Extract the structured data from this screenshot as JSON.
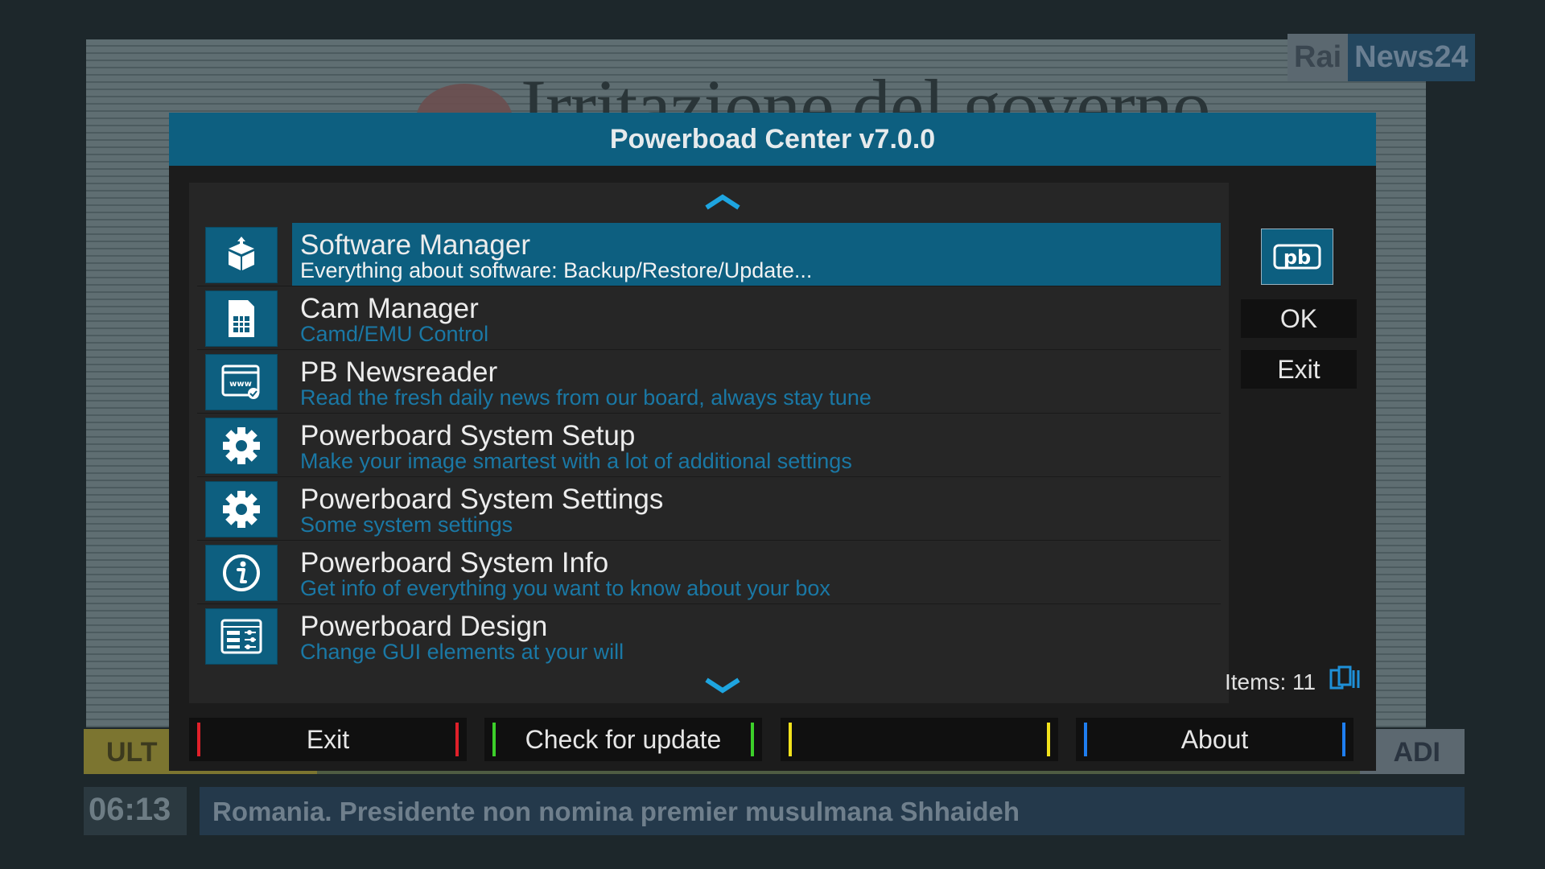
{
  "background": {
    "headline": "Irritazione del governo",
    "channel": {
      "rai": "Rai",
      "news": "News24"
    },
    "ticker": {
      "left": "ULT",
      "right": "ADI"
    },
    "clock": "06:13",
    "crawl": "Romania. Presidente non nomina premier musulmana Shhaideh"
  },
  "dialog": {
    "title": "Powerboad Center v7.0.0",
    "menu": [
      {
        "title": "Software Manager",
        "subtitle": "Everything about software: Backup/Restore/Update...",
        "icon": "package-icon",
        "selected": true
      },
      {
        "title": "Cam Manager",
        "subtitle": "Camd/EMU Control",
        "icon": "sim-card-icon",
        "selected": false
      },
      {
        "title": "PB Newsreader",
        "subtitle": "Read the fresh daily news from our board, always stay tune",
        "icon": "www-browser-icon",
        "selected": false
      },
      {
        "title": "Powerboard System Setup",
        "subtitle": "Make your image smartest with a lot of additional settings",
        "icon": "gear-icon",
        "selected": false
      },
      {
        "title": "Powerboard System Settings",
        "subtitle": "Some system settings",
        "icon": "gear-icon",
        "selected": false
      },
      {
        "title": "Powerboard System Info",
        "subtitle": "Get info of everything you want to know about your box",
        "icon": "info-icon",
        "selected": false
      },
      {
        "title": "Powerboard Design",
        "subtitle": "Change GUI elements at your will",
        "icon": "design-panel-icon",
        "selected": false
      }
    ],
    "side": {
      "logo_text": "pb",
      "ok_label": "OK",
      "exit_label": "Exit",
      "items_label": "Items: 11"
    },
    "footer": {
      "red": "Exit",
      "green": "Check for update",
      "yellow": "",
      "blue": "About"
    }
  },
  "colors": {
    "accent": "#0d5f80",
    "subtitle": "#1a78a5",
    "arrow": "#1ea5e0",
    "red_key": "#e0202a",
    "green_key": "#3ccf2a",
    "yellow_key": "#f2e21c",
    "blue_key": "#1f7ef0"
  }
}
